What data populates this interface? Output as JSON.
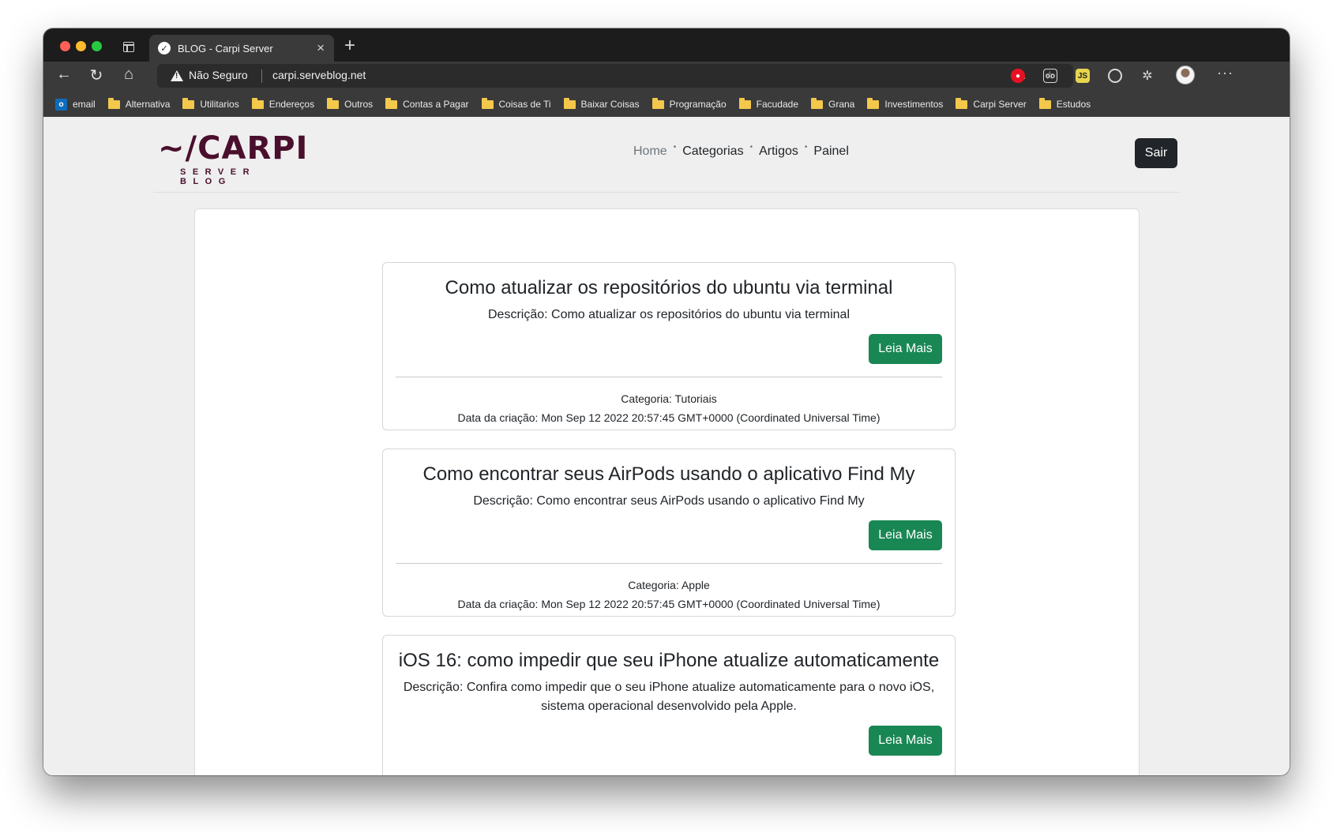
{
  "browser": {
    "tab_title": "BLOG - Carpi Server",
    "tab_favicon": "carpi-logo-icon",
    "security_label": "Não Seguro",
    "url": "carpi.serveblog.net",
    "bookmarks": [
      {
        "label": "email",
        "icon": "outlook-icon"
      },
      {
        "label": "Alternativa",
        "icon": "folder-icon"
      },
      {
        "label": "Utilitarios",
        "icon": "folder-icon"
      },
      {
        "label": "Endereços",
        "icon": "folder-icon"
      },
      {
        "label": "Outros",
        "icon": "folder-icon"
      },
      {
        "label": "Contas a Pagar",
        "icon": "folder-icon"
      },
      {
        "label": "Coisas de Ti",
        "icon": "folder-icon"
      },
      {
        "label": "Baixar Coisas",
        "icon": "folder-icon"
      },
      {
        "label": "Programação",
        "icon": "folder-icon"
      },
      {
        "label": "Facudade",
        "icon": "folder-icon"
      },
      {
        "label": "Grana",
        "icon": "folder-icon"
      },
      {
        "label": "Investimentos",
        "icon": "folder-icon"
      },
      {
        "label": "Carpi Server",
        "icon": "folder-icon"
      },
      {
        "label": "Estudos",
        "icon": "folder-icon"
      }
    ]
  },
  "site": {
    "logo_main": "~/CARPI",
    "logo_sub": "SERVER BLOG",
    "nav": {
      "home": "Home",
      "categories": "Categorias",
      "articles": "Artigos",
      "panel": "Painel"
    },
    "logout_label": "Sair"
  },
  "articles": [
    {
      "title": "Como atualizar os repositórios do ubuntu via terminal",
      "description": "Descrição: Como atualizar os repositórios do ubuntu via terminal",
      "button": "Leia Mais",
      "category": "Categoria: Tutoriais",
      "created": "Data da criação: Mon Sep 12 2022 20:57:45 GMT+0000 (Coordinated Universal Time)"
    },
    {
      "title": "Como encontrar seus AirPods usando o aplicativo Find My",
      "description": "Descrição: Como encontrar seus AirPods usando o aplicativo Find My",
      "button": "Leia Mais",
      "category": "Categoria: Apple",
      "created": "Data da criação: Mon Sep 12 2022 20:57:45 GMT+0000 (Coordinated Universal Time)"
    },
    {
      "title": "iOS 16: como impedir que seu iPhone atualize automaticamente",
      "description": "Descrição: Confira como impedir que o seu iPhone atualize automaticamente para o novo iOS, sistema operacional desenvolvido pela Apple.",
      "button": "Leia Mais"
    }
  ],
  "colors": {
    "brand": "#4a0f2c",
    "read_more_button": "#198754",
    "logout_button": "#212529"
  }
}
